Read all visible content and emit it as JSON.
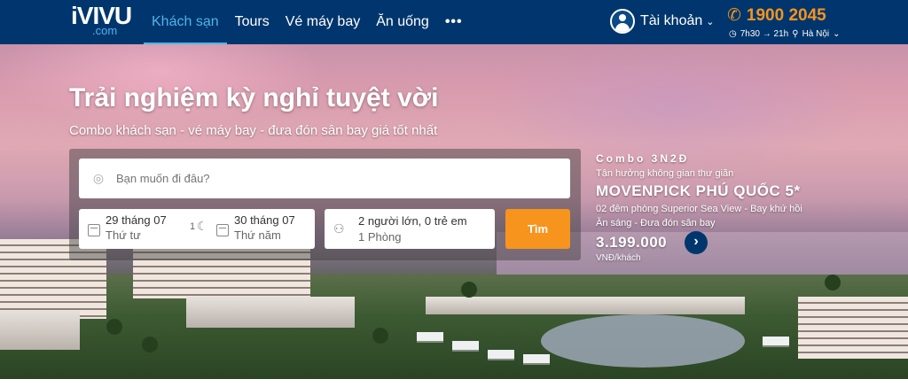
{
  "header": {
    "logo_main": "iVIVU",
    "logo_sub": ".com",
    "nav": [
      {
        "label": "Khách sạn",
        "active": true
      },
      {
        "label": "Tours"
      },
      {
        "label": "Vé máy bay"
      },
      {
        "label": "Ăn uống"
      }
    ],
    "more_label": "•••",
    "account_label": "Tài khoản",
    "hotline": "1900 2045",
    "hours": "7h30 → 21h",
    "location": "Hà Nội"
  },
  "hero": {
    "headline": "Trải nghiệm kỳ nghỉ tuyệt vời",
    "subline": "Combo khách sạn - vé máy bay - đưa đón sân bay giá tốt nhất"
  },
  "search": {
    "destination_placeholder": "Bạn muốn đi đâu?",
    "checkin_date": "29 tháng 07",
    "checkin_day": "Thứ tư",
    "nights": "1",
    "checkout_date": "30 tháng 07",
    "checkout_day": "Thứ năm",
    "guests": "2 người lớn, 0 trẻ em",
    "rooms": "1 Phòng",
    "button_label": "Tìm"
  },
  "promo": {
    "kicker": "Combo 3N2Đ",
    "tagline": "Tận hưởng không gian thư giãn",
    "name": "MOVENPICK PHÚ QUỐC 5*",
    "detail_1": "02 đêm phòng Superior Sea View - Bay khứ hồi",
    "detail_2": "Ăn sáng - Đưa đón sân bay",
    "price": "3.199.000",
    "unit": "VNĐ/khách"
  },
  "colors": {
    "nav_bg": "#00366d",
    "accent": "#f7941d",
    "active": "#4fb4ea"
  }
}
